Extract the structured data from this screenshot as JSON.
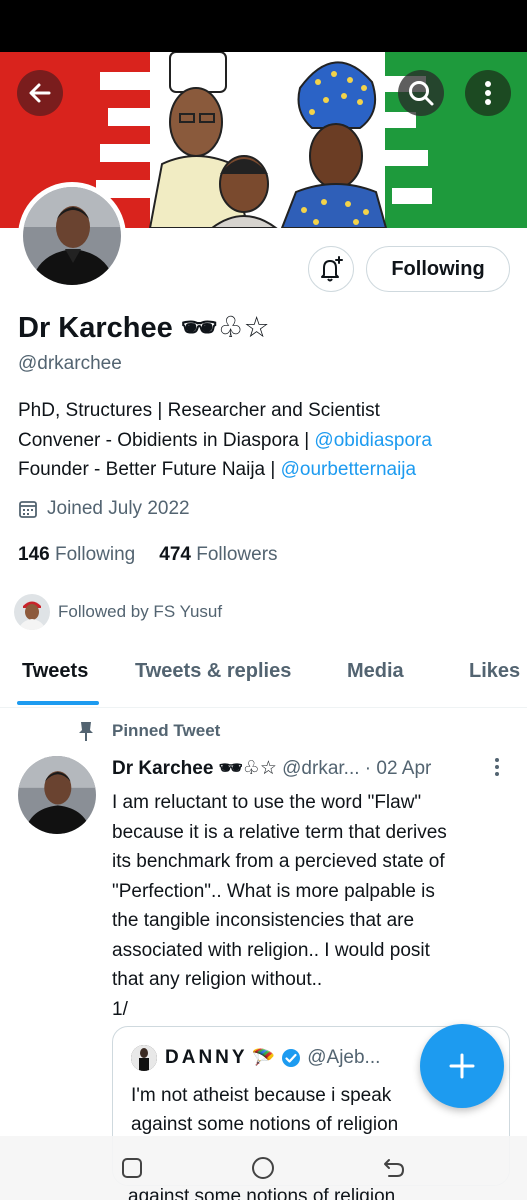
{
  "profile": {
    "name": "Dr Karchee 🕶♧☆",
    "handle": "@drkarchee",
    "bio_lines": [
      {
        "text": "PhD, Structures | Researcher and Scientist",
        "link": ""
      },
      {
        "text": "Convener - Obidients in Diaspora | ",
        "link": "@obidiaspora"
      },
      {
        "text": "Founder - Better Future Naija | ",
        "link": "@ourbetternaija"
      }
    ],
    "joined": "Joined July 2022",
    "following_count": "146",
    "following_label": "Following",
    "followers_count": "474",
    "followers_label": "Followers",
    "followed_by": "Followed by FS Yusuf"
  },
  "actions": {
    "following_button": "Following"
  },
  "tabs": [
    {
      "label": "Tweets",
      "active": true
    },
    {
      "label": "Tweets & replies",
      "active": false
    },
    {
      "label": "Media",
      "active": false
    },
    {
      "label": "Likes",
      "active": false
    }
  ],
  "pinned_tweet": {
    "pinned_label": "Pinned Tweet",
    "author": "Dr Karchee 🕶♧☆",
    "handle": "@drkar...",
    "date": "· 02 Apr",
    "text_lines": [
      "I am reluctant to use the word \"Flaw\"",
      "because it is a relative term that derives",
      "its benchmark from a percieved state of",
      "\"Perfection\".. What is more palpable is",
      "the tangible inconsistencies that are",
      "associated with religion.. I would posit",
      "that any religion without..",
      "1/"
    ],
    "quote": {
      "author": "DANNY",
      "author_emoji": "🪂",
      "handle": "@Ajeb...",
      "text_lines": [
        "I'm not atheist because i speak",
        "against some notions of religion"
      ]
    }
  },
  "nav_ghost_text": "against some notions of religion",
  "colors": {
    "accent": "#1d9bf0",
    "text_secondary": "#536471",
    "banner_red": "#d9231d",
    "banner_green": "#1e9a3c"
  },
  "icons": {
    "back": "arrow-left-icon",
    "search": "search-icon",
    "more": "more-vertical-icon",
    "notify": "bell-plus-icon",
    "calendar": "calendar-icon",
    "pin": "pin-icon",
    "compose": "plus-icon",
    "verified": "verified-badge-icon"
  }
}
